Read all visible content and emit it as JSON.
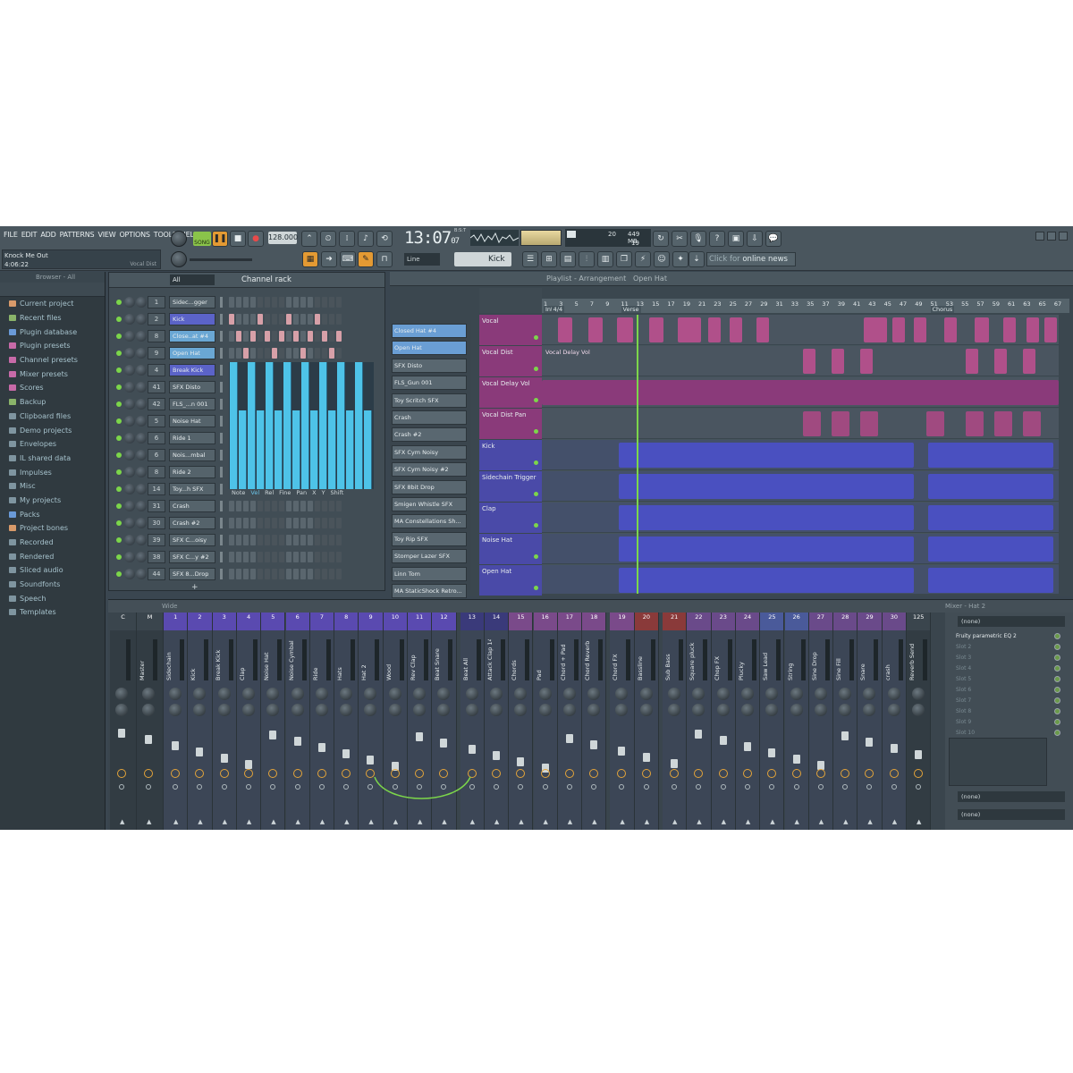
{
  "menu": [
    "FILE",
    "EDIT",
    "ADD",
    "PATTERNS",
    "VIEW",
    "OPTIONS",
    "TOOLS",
    "HELP"
  ],
  "song": {
    "title": "Knock Me Out",
    "time": "4:06:22",
    "hint": "Vocal Dist"
  },
  "transport": {
    "mode": "SONG",
    "tempo": "128.000",
    "clock_main": "13:07",
    "clock_sub": "07",
    "clock_label": "B:S:T"
  },
  "cpu": {
    "memory": "449 MB",
    "voices": "19",
    "poly": "20"
  },
  "toolbar": {
    "snap": "Line",
    "pattern": "Kick",
    "news_prefix": "Click for ",
    "news_link": "online news"
  },
  "browser": {
    "header": "Browser - All",
    "items": [
      {
        "label": "Current project",
        "color": "#d89a6a"
      },
      {
        "label": "Recent files",
        "color": "#8ab46a"
      },
      {
        "label": "Plugin database",
        "color": "#6a9ad8"
      },
      {
        "label": "Plugin presets",
        "color": "#c86aa8"
      },
      {
        "label": "Channel presets",
        "color": "#c86aa8"
      },
      {
        "label": "Mixer presets",
        "color": "#c86aa8"
      },
      {
        "label": "Scores",
        "color": "#c86aa8"
      },
      {
        "label": "Backup",
        "color": "#8ab46a"
      },
      {
        "label": "Clipboard files",
        "color": "#7f95a0"
      },
      {
        "label": "Demo projects",
        "color": "#7f95a0"
      },
      {
        "label": "Envelopes",
        "color": "#7f95a0"
      },
      {
        "label": "IL shared data",
        "color": "#7f95a0"
      },
      {
        "label": "Impulses",
        "color": "#7f95a0"
      },
      {
        "label": "Misc",
        "color": "#7f95a0"
      },
      {
        "label": "My projects",
        "color": "#7f95a0"
      },
      {
        "label": "Packs",
        "color": "#6a9ad8"
      },
      {
        "label": "Project bones",
        "color": "#d89a6a"
      },
      {
        "label": "Recorded",
        "color": "#7f95a0"
      },
      {
        "label": "Rendered",
        "color": "#7f95a0"
      },
      {
        "label": "Sliced audio",
        "color": "#7f95a0"
      },
      {
        "label": "Soundfonts",
        "color": "#7f95a0"
      },
      {
        "label": "Speech",
        "color": "#7f95a0"
      },
      {
        "label": "Templates",
        "color": "#7f95a0"
      }
    ]
  },
  "rack": {
    "title": "Channel rack",
    "filter": "All",
    "channels": [
      {
        "num": "1",
        "name": "Sidec...gger"
      },
      {
        "num": "2",
        "name": "Kick",
        "style": "sel"
      },
      {
        "num": "8",
        "name": "Close..at #4",
        "style": "sel2"
      },
      {
        "num": "9",
        "name": "Open Hat",
        "style": "sel2"
      },
      {
        "num": "4",
        "name": "Break Kick",
        "style": "sel"
      },
      {
        "num": "41",
        "name": "SFX Disto"
      },
      {
        "num": "42",
        "name": "FLS_...n 001"
      },
      {
        "num": "5",
        "name": "Noise Hat"
      },
      {
        "num": "6",
        "name": "Ride 1"
      },
      {
        "num": "6",
        "name": "Nois...mbal"
      },
      {
        "num": "8",
        "name": "Ride 2"
      },
      {
        "num": "14",
        "name": "Toy...h SFX"
      },
      {
        "num": "31",
        "name": "Crash"
      },
      {
        "num": "30",
        "name": "Crash #2"
      },
      {
        "num": "39",
        "name": "SFX C...oisy"
      },
      {
        "num": "38",
        "name": "SFX C...y #2"
      },
      {
        "num": "44",
        "name": "SFX 8...Drop"
      }
    ],
    "vel_tabs": [
      "Note",
      "Vel",
      "Rel",
      "Fine",
      "Pan",
      "X",
      "Y",
      "Shift"
    ]
  },
  "patterns": [
    "Closed Hat #4",
    "Open Hat",
    "SFX Disto",
    "FLS_Gun 001",
    "Toy Scritch SFX",
    "Crash",
    "Crash #2",
    "SFX Cym Noisy",
    "SFX Cym Noisy #2",
    "SFX 8bit Drop",
    "Smigen Whistle SFX",
    "MA Constellations Sh...",
    "Toy Rip SFX",
    "Stomper Lazer SFX",
    "Linn Tom",
    "MA StaticShock Retro..."
  ],
  "playlist": {
    "title": "Playlist - Arrangement",
    "crumb": "Open Hat",
    "ruler": [
      "1",
      "3",
      "5",
      "7",
      "9",
      "11",
      "13",
      "15",
      "17",
      "19",
      "21",
      "23",
      "25",
      "27",
      "29",
      "31",
      "33",
      "35",
      "37",
      "39",
      "41",
      "43",
      "45",
      "47",
      "49",
      "51",
      "53",
      "55",
      "57",
      "59",
      "61",
      "63",
      "65",
      "67"
    ],
    "markers": [
      {
        "label": "Intro",
        "bar": 1
      },
      {
        "label": "4/4",
        "bar": 2
      },
      {
        "label": "Verse",
        "bar": 11
      },
      {
        "label": "Chorus",
        "bar": 51
      }
    ],
    "tracks": [
      {
        "name": "Vocal",
        "color": "#8a3a7a"
      },
      {
        "name": "Vocal Dist",
        "color": "#8a3a7a"
      },
      {
        "name": "Vocal Delay Vol",
        "color": "#8a3a7a"
      },
      {
        "name": "Vocal Dist Pan",
        "color": "#8a3a7a"
      },
      {
        "name": "Kick",
        "color": "#4a4aa8"
      },
      {
        "name": "Sidechain Trigger",
        "color": "#4a4aa8"
      },
      {
        "name": "Clap",
        "color": "#4a4aa8"
      },
      {
        "name": "Noise Hat",
        "color": "#4a4aa8"
      },
      {
        "name": "Open Hat",
        "color": "#4a4aa8"
      }
    ],
    "auto_clip": "Vocal Delay Vol"
  },
  "mixer": {
    "mode": "Wide",
    "title": "Mixer - Hat 2",
    "strips": [
      {
        "num": "C",
        "name": "",
        "color": "#3a454d"
      },
      {
        "num": "M",
        "name": "Master",
        "color": "#3a454d"
      },
      {
        "num": "1",
        "name": "Sidechain",
        "color": "#5a4ab0"
      },
      {
        "num": "2",
        "name": "Kick",
        "color": "#5a4ab0"
      },
      {
        "num": "3",
        "name": "Break Kick",
        "color": "#5a4ab0"
      },
      {
        "num": "4",
        "name": "Clap",
        "color": "#5a4ab0"
      },
      {
        "num": "5",
        "name": "Noise Hat",
        "color": "#5a4ab0"
      },
      {
        "num": "6",
        "name": "Noise Cymbal",
        "color": "#5a4ab0"
      },
      {
        "num": "7",
        "name": "Ride",
        "color": "#5a4ab0"
      },
      {
        "num": "8",
        "name": "Hats",
        "color": "#5a4ab0"
      },
      {
        "num": "9",
        "name": "Hat 2",
        "color": "#5a4ab0"
      },
      {
        "num": "10",
        "name": "Wood",
        "color": "#5a4ab0"
      },
      {
        "num": "11",
        "name": "Rev Clap",
        "color": "#5a4ab0"
      },
      {
        "num": "12",
        "name": "Beat Snare",
        "color": "#5a4ab0"
      },
      {
        "num": "13",
        "name": "Beat All",
        "color": "#3a3a7a"
      },
      {
        "num": "14",
        "name": "Attack Clap 14",
        "color": "#3a3a7a"
      },
      {
        "num": "15",
        "name": "Chords",
        "color": "#7a4a8a"
      },
      {
        "num": "16",
        "name": "Pad",
        "color": "#7a4a8a"
      },
      {
        "num": "17",
        "name": "Chord + Pad",
        "color": "#7a4a8a"
      },
      {
        "num": "18",
        "name": "Chord Reverb",
        "color": "#7a4a8a"
      },
      {
        "num": "19",
        "name": "Chord FX",
        "color": "#7a4a8a"
      },
      {
        "num": "20",
        "name": "Bassline",
        "color": "#8a3a3a"
      },
      {
        "num": "21",
        "name": "Sub Bass",
        "color": "#8a3a3a"
      },
      {
        "num": "22",
        "name": "Square pluck",
        "color": "#6a4a8a"
      },
      {
        "num": "23",
        "name": "Chop FX",
        "color": "#6a4a8a"
      },
      {
        "num": "24",
        "name": "Plucky",
        "color": "#6a4a8a"
      },
      {
        "num": "25",
        "name": "Saw Lead",
        "color": "#4a5a9a"
      },
      {
        "num": "26",
        "name": "String",
        "color": "#4a5a9a"
      },
      {
        "num": "27",
        "name": "Sine Drop",
        "color": "#6a4a8a"
      },
      {
        "num": "28",
        "name": "Sine Fill",
        "color": "#6a4a8a"
      },
      {
        "num": "29",
        "name": "Snare",
        "color": "#6a4a8a"
      },
      {
        "num": "30",
        "name": "crash",
        "color": "#6a4a8a"
      },
      {
        "num": "125",
        "name": "Reverb Send",
        "color": "#3a454d"
      }
    ],
    "fx_input": "(none)",
    "slots": [
      "Fruity parametric EQ 2",
      "Slot 2",
      "Slot 3",
      "Slot 4",
      "Slot 5",
      "Slot 6",
      "Slot 7",
      "Slot 8",
      "Slot 9",
      "Slot 10"
    ],
    "out1": "(none)",
    "out2": "(none)"
  }
}
